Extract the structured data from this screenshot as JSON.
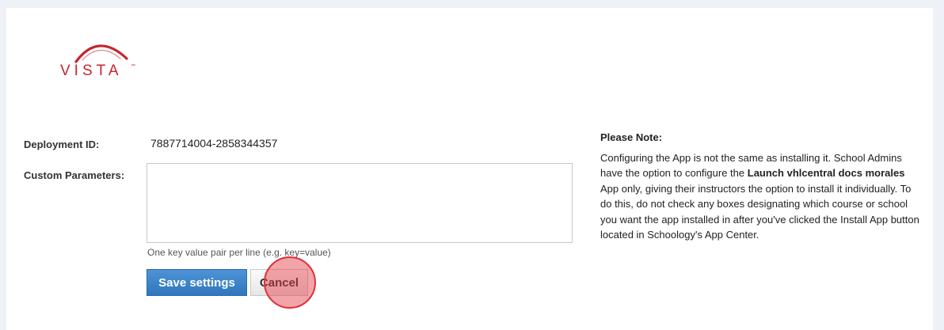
{
  "logo": {
    "text": "VISTA",
    "tm": "™"
  },
  "form": {
    "deployment_label": "Deployment ID:",
    "deployment_value": "7887714004-2858344357",
    "params_label": "Custom Parameters:",
    "params_value": "",
    "params_help": "One key value pair per line (e.g. key=value)",
    "save_label": "Save settings",
    "cancel_label": "Cancel"
  },
  "note": {
    "title": "Please Note:",
    "text_before": "Configuring the App is not the same as installing it. School Admins have the option to configure the ",
    "app_name": "Launch vhlcentral docs morales",
    "text_after": " App only, giving their instructors the option to install it individually. To do this, do not check any boxes designating which course or school you want the app installed in after you've clicked the Install App button located in Schoology's App Center."
  },
  "colors": {
    "brand_red": "#c2272d",
    "save_button": "#3a82c8",
    "click_marker": "#e0303a"
  }
}
